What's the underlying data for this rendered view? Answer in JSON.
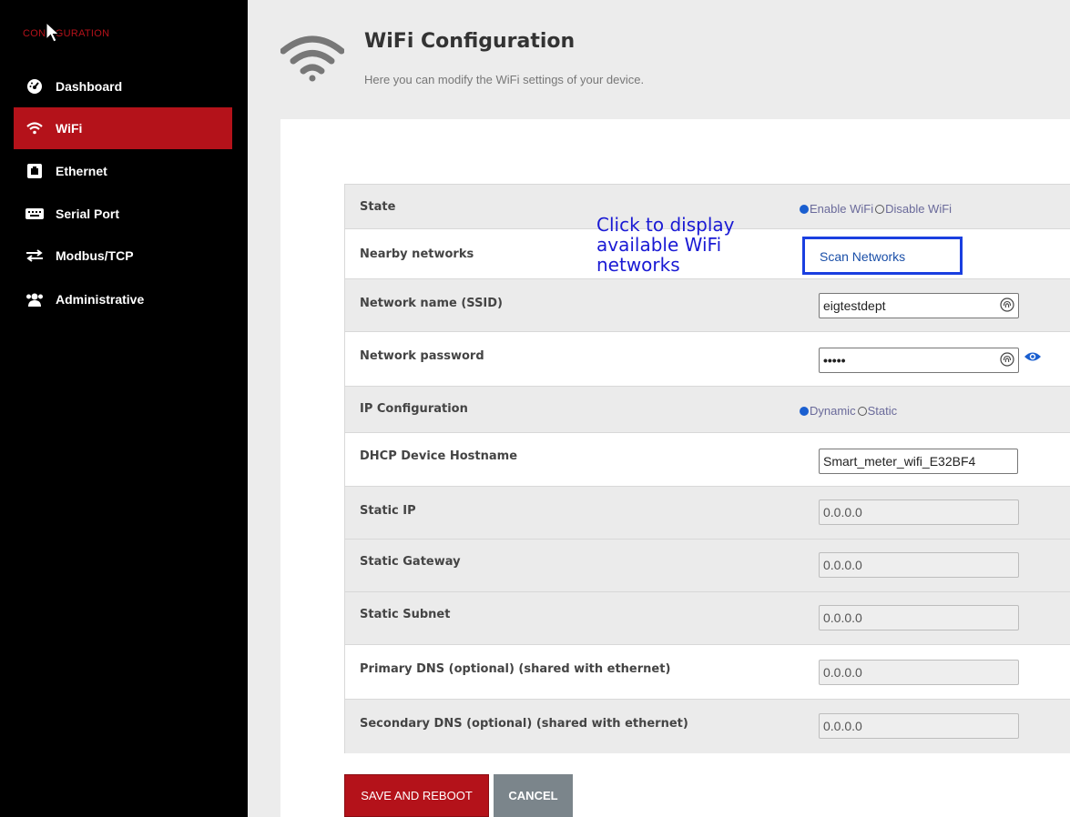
{
  "sidebar": {
    "brand": "CONFIGURATION",
    "items": [
      {
        "label": "Dashboard",
        "icon": "dashboard-icon"
      },
      {
        "label": "WiFi",
        "icon": "wifi-icon"
      },
      {
        "label": "Ethernet",
        "icon": "ethernet-icon"
      },
      {
        "label": "Serial Port",
        "icon": "serial-port-icon"
      },
      {
        "label": "Modbus/TCP",
        "icon": "exchange-arrows-icon"
      },
      {
        "label": "Administrative",
        "icon": "users-icon"
      }
    ],
    "active_index": 1
  },
  "header": {
    "title": "WiFi Configuration",
    "subtitle": "Here you can modify the WiFi settings of your device."
  },
  "form": {
    "state": {
      "label": "State",
      "enable": "Enable WiFi",
      "disable": "Disable WiFi",
      "selected": "Enable WiFi"
    },
    "nearby": {
      "label": "Nearby networks",
      "button": "Scan Networks"
    },
    "ssid": {
      "label": "Network name (SSID)",
      "value": "eigtestdept"
    },
    "password": {
      "label": "Network password",
      "value": "•••••"
    },
    "ip_config": {
      "label": "IP Configuration",
      "dynamic": "Dynamic",
      "static": "Static",
      "selected": "Dynamic"
    },
    "hostname": {
      "label": "DHCP Device Hostname",
      "value": "Smart_meter_wifi_E32BF4"
    },
    "static_ip": {
      "label": "Static IP",
      "value": "0.0.0.0"
    },
    "static_gateway": {
      "label": "Static Gateway",
      "value": "0.0.0.0"
    },
    "static_subnet": {
      "label": "Static Subnet",
      "value": "0.0.0.0"
    },
    "primary_dns": {
      "label": "Primary DNS (optional) (shared with ethernet)",
      "value": "0.0.0.0"
    },
    "secondary_dns": {
      "label": "Secondary DNS (optional) (shared with ethernet)",
      "value": "0.0.0.0"
    }
  },
  "annotation": "Click to display\navailable WiFi\nnetworks",
  "actions": {
    "save": "SAVE AND REBOOT",
    "cancel": "CANCEL"
  },
  "colors": {
    "accent": "#b4121a",
    "sidebar_bg": "#000000",
    "annotation": "#1a1ad4",
    "highlight_box": "#1a3fe0"
  }
}
